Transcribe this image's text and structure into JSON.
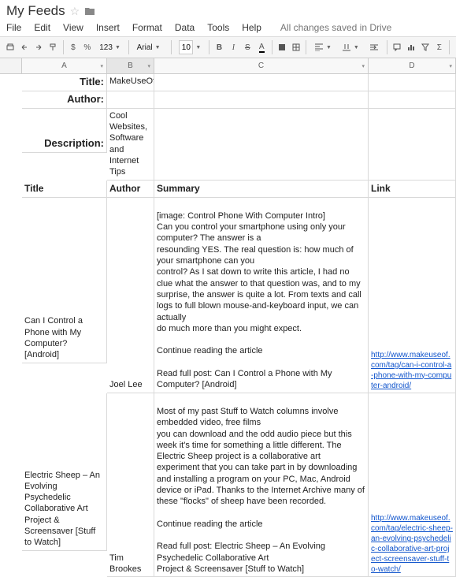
{
  "doc": {
    "title": "My Feeds",
    "save_status": "All changes saved in Drive"
  },
  "menu": {
    "file": "File",
    "edit": "Edit",
    "view": "View",
    "insert": "Insert",
    "format": "Format",
    "data": "Data",
    "tools": "Tools",
    "help": "Help"
  },
  "toolbar": {
    "currency": "$",
    "percent": "%",
    "number": "123",
    "font": "Arial",
    "size": "10",
    "bold": "B",
    "italic": "I",
    "strike": "S"
  },
  "cols": {
    "a": "A",
    "b": "B",
    "c": "C",
    "d": "D"
  },
  "meta": {
    "title_label": "Title:",
    "title_value": "MakeUseOf",
    "author_label": "Author:",
    "author_value": "",
    "desc_label": "Description:",
    "desc_value": "Cool\nWebsites,\nSoftware and\nInternet Tips"
  },
  "headers": {
    "title": "Title",
    "author": "Author",
    "summary": "Summary",
    "link": "Link"
  },
  "rows": [
    {
      "title": "Can I Control a Phone with My Computer? [Android]",
      "author": "Joel Lee",
      "summary": "\n[image: Control Phone With Computer Intro]\nCan you control your smartphone using only your computer? The answer is a\nresounding YES. The real question is: how much of your smartphone can you\ncontrol? As I sat down to write this article, I had no clue what the answer to that question was, and to my surprise, the answer is quite a lot. From texts and call logs to full blown mouse-and-keyboard input, we can actually\ndo much more than you might expect.\n\nContinue reading the article\n\nRead full post: Can I Control a Phone with My Computer? [Android]",
      "link": "http://www.makeuseof.com/tag/can-i-control-a-phone-with-my-computer-android/"
    },
    {
      "title": "Electric Sheep – An Evolving Psychedelic Collaborative Art Project & Screensaver [Stuff to Watch]",
      "author": "Tim Brookes",
      "summary": "\nMost of my past Stuff to Watch columns involve embedded video, free films\nyou can download and the odd audio piece but this week it's time for something a little different. The Electric Sheep project is a collaborative art experiment that you can take part in by downloading and installing a program on your PC, Mac, Android device or iPad. Thanks to the Internet Archive many of these \"flocks\" of sheep have been recorded.\n\nContinue reading the article\n\nRead full post: Electric Sheep – An Evolving Psychedelic Collaborative Art\nProject & Screensaver [Stuff to Watch]",
      "link": "http://www.makeuseof.com/tag/electric-sheep-an-evolving-psychedelic-collaborative-art-project-screensaver-stuff-to-watch/"
    }
  ]
}
